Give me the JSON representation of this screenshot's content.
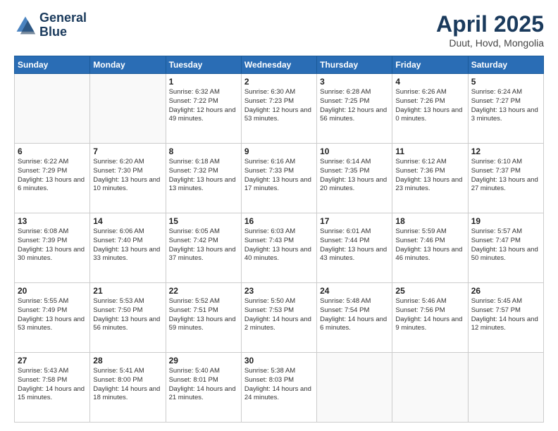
{
  "header": {
    "logo_line1": "General",
    "logo_line2": "Blue",
    "title": "April 2025",
    "subtitle": "Duut, Hovd, Mongolia"
  },
  "weekdays": [
    "Sunday",
    "Monday",
    "Tuesday",
    "Wednesday",
    "Thursday",
    "Friday",
    "Saturday"
  ],
  "weeks": [
    [
      {
        "day": null,
        "sunrise": null,
        "sunset": null,
        "daylight": null
      },
      {
        "day": null,
        "sunrise": null,
        "sunset": null,
        "daylight": null
      },
      {
        "day": "1",
        "sunrise": "Sunrise: 6:32 AM",
        "sunset": "Sunset: 7:22 PM",
        "daylight": "Daylight: 12 hours and 49 minutes."
      },
      {
        "day": "2",
        "sunrise": "Sunrise: 6:30 AM",
        "sunset": "Sunset: 7:23 PM",
        "daylight": "Daylight: 12 hours and 53 minutes."
      },
      {
        "day": "3",
        "sunrise": "Sunrise: 6:28 AM",
        "sunset": "Sunset: 7:25 PM",
        "daylight": "Daylight: 12 hours and 56 minutes."
      },
      {
        "day": "4",
        "sunrise": "Sunrise: 6:26 AM",
        "sunset": "Sunset: 7:26 PM",
        "daylight": "Daylight: 13 hours and 0 minutes."
      },
      {
        "day": "5",
        "sunrise": "Sunrise: 6:24 AM",
        "sunset": "Sunset: 7:27 PM",
        "daylight": "Daylight: 13 hours and 3 minutes."
      }
    ],
    [
      {
        "day": "6",
        "sunrise": "Sunrise: 6:22 AM",
        "sunset": "Sunset: 7:29 PM",
        "daylight": "Daylight: 13 hours and 6 minutes."
      },
      {
        "day": "7",
        "sunrise": "Sunrise: 6:20 AM",
        "sunset": "Sunset: 7:30 PM",
        "daylight": "Daylight: 13 hours and 10 minutes."
      },
      {
        "day": "8",
        "sunrise": "Sunrise: 6:18 AM",
        "sunset": "Sunset: 7:32 PM",
        "daylight": "Daylight: 13 hours and 13 minutes."
      },
      {
        "day": "9",
        "sunrise": "Sunrise: 6:16 AM",
        "sunset": "Sunset: 7:33 PM",
        "daylight": "Daylight: 13 hours and 17 minutes."
      },
      {
        "day": "10",
        "sunrise": "Sunrise: 6:14 AM",
        "sunset": "Sunset: 7:35 PM",
        "daylight": "Daylight: 13 hours and 20 minutes."
      },
      {
        "day": "11",
        "sunrise": "Sunrise: 6:12 AM",
        "sunset": "Sunset: 7:36 PM",
        "daylight": "Daylight: 13 hours and 23 minutes."
      },
      {
        "day": "12",
        "sunrise": "Sunrise: 6:10 AM",
        "sunset": "Sunset: 7:37 PM",
        "daylight": "Daylight: 13 hours and 27 minutes."
      }
    ],
    [
      {
        "day": "13",
        "sunrise": "Sunrise: 6:08 AM",
        "sunset": "Sunset: 7:39 PM",
        "daylight": "Daylight: 13 hours and 30 minutes."
      },
      {
        "day": "14",
        "sunrise": "Sunrise: 6:06 AM",
        "sunset": "Sunset: 7:40 PM",
        "daylight": "Daylight: 13 hours and 33 minutes."
      },
      {
        "day": "15",
        "sunrise": "Sunrise: 6:05 AM",
        "sunset": "Sunset: 7:42 PM",
        "daylight": "Daylight: 13 hours and 37 minutes."
      },
      {
        "day": "16",
        "sunrise": "Sunrise: 6:03 AM",
        "sunset": "Sunset: 7:43 PM",
        "daylight": "Daylight: 13 hours and 40 minutes."
      },
      {
        "day": "17",
        "sunrise": "Sunrise: 6:01 AM",
        "sunset": "Sunset: 7:44 PM",
        "daylight": "Daylight: 13 hours and 43 minutes."
      },
      {
        "day": "18",
        "sunrise": "Sunrise: 5:59 AM",
        "sunset": "Sunset: 7:46 PM",
        "daylight": "Daylight: 13 hours and 46 minutes."
      },
      {
        "day": "19",
        "sunrise": "Sunrise: 5:57 AM",
        "sunset": "Sunset: 7:47 PM",
        "daylight": "Daylight: 13 hours and 50 minutes."
      }
    ],
    [
      {
        "day": "20",
        "sunrise": "Sunrise: 5:55 AM",
        "sunset": "Sunset: 7:49 PM",
        "daylight": "Daylight: 13 hours and 53 minutes."
      },
      {
        "day": "21",
        "sunrise": "Sunrise: 5:53 AM",
        "sunset": "Sunset: 7:50 PM",
        "daylight": "Daylight: 13 hours and 56 minutes."
      },
      {
        "day": "22",
        "sunrise": "Sunrise: 5:52 AM",
        "sunset": "Sunset: 7:51 PM",
        "daylight": "Daylight: 13 hours and 59 minutes."
      },
      {
        "day": "23",
        "sunrise": "Sunrise: 5:50 AM",
        "sunset": "Sunset: 7:53 PM",
        "daylight": "Daylight: 14 hours and 2 minutes."
      },
      {
        "day": "24",
        "sunrise": "Sunrise: 5:48 AM",
        "sunset": "Sunset: 7:54 PM",
        "daylight": "Daylight: 14 hours and 6 minutes."
      },
      {
        "day": "25",
        "sunrise": "Sunrise: 5:46 AM",
        "sunset": "Sunset: 7:56 PM",
        "daylight": "Daylight: 14 hours and 9 minutes."
      },
      {
        "day": "26",
        "sunrise": "Sunrise: 5:45 AM",
        "sunset": "Sunset: 7:57 PM",
        "daylight": "Daylight: 14 hours and 12 minutes."
      }
    ],
    [
      {
        "day": "27",
        "sunrise": "Sunrise: 5:43 AM",
        "sunset": "Sunset: 7:58 PM",
        "daylight": "Daylight: 14 hours and 15 minutes."
      },
      {
        "day": "28",
        "sunrise": "Sunrise: 5:41 AM",
        "sunset": "Sunset: 8:00 PM",
        "daylight": "Daylight: 14 hours and 18 minutes."
      },
      {
        "day": "29",
        "sunrise": "Sunrise: 5:40 AM",
        "sunset": "Sunset: 8:01 PM",
        "daylight": "Daylight: 14 hours and 21 minutes."
      },
      {
        "day": "30",
        "sunrise": "Sunrise: 5:38 AM",
        "sunset": "Sunset: 8:03 PM",
        "daylight": "Daylight: 14 hours and 24 minutes."
      },
      {
        "day": null,
        "sunrise": null,
        "sunset": null,
        "daylight": null
      },
      {
        "day": null,
        "sunrise": null,
        "sunset": null,
        "daylight": null
      },
      {
        "day": null,
        "sunrise": null,
        "sunset": null,
        "daylight": null
      }
    ]
  ]
}
